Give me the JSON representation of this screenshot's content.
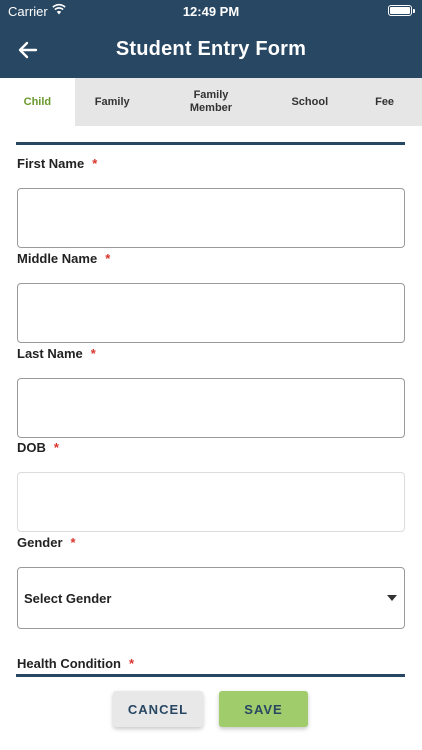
{
  "status": {
    "carrier": "Carrier",
    "time": "12:49 PM"
  },
  "header": {
    "title": "Student Entry Form"
  },
  "tabs": [
    {
      "label": "Child",
      "active": true
    },
    {
      "label": "Family",
      "active": false
    },
    {
      "label": "Family Member",
      "active": false
    },
    {
      "label": "School",
      "active": false
    },
    {
      "label": "Fee",
      "active": false
    }
  ],
  "form": {
    "required_marker": "*",
    "first_name": {
      "label": "First Name",
      "value": ""
    },
    "middle_name": {
      "label": "Middle Name",
      "value": ""
    },
    "last_name": {
      "label": "Last Name",
      "value": ""
    },
    "dob": {
      "label": "DOB",
      "value": ""
    },
    "gender": {
      "label": "Gender",
      "selected": "Select Gender"
    },
    "health_condition": {
      "label": "Health Condition"
    }
  },
  "actions": {
    "cancel_label": "CANCEL",
    "save_label": "SAVE"
  },
  "colors": {
    "header": "#284762",
    "active_tab_text": "#6a9a2e",
    "save_button": "#a0cc6c",
    "required": "#d9342b"
  },
  "icons": {
    "back": "arrow-left-icon",
    "wifi": "wifi-icon",
    "battery": "battery-icon",
    "dropdown": "chevron-down-icon"
  }
}
